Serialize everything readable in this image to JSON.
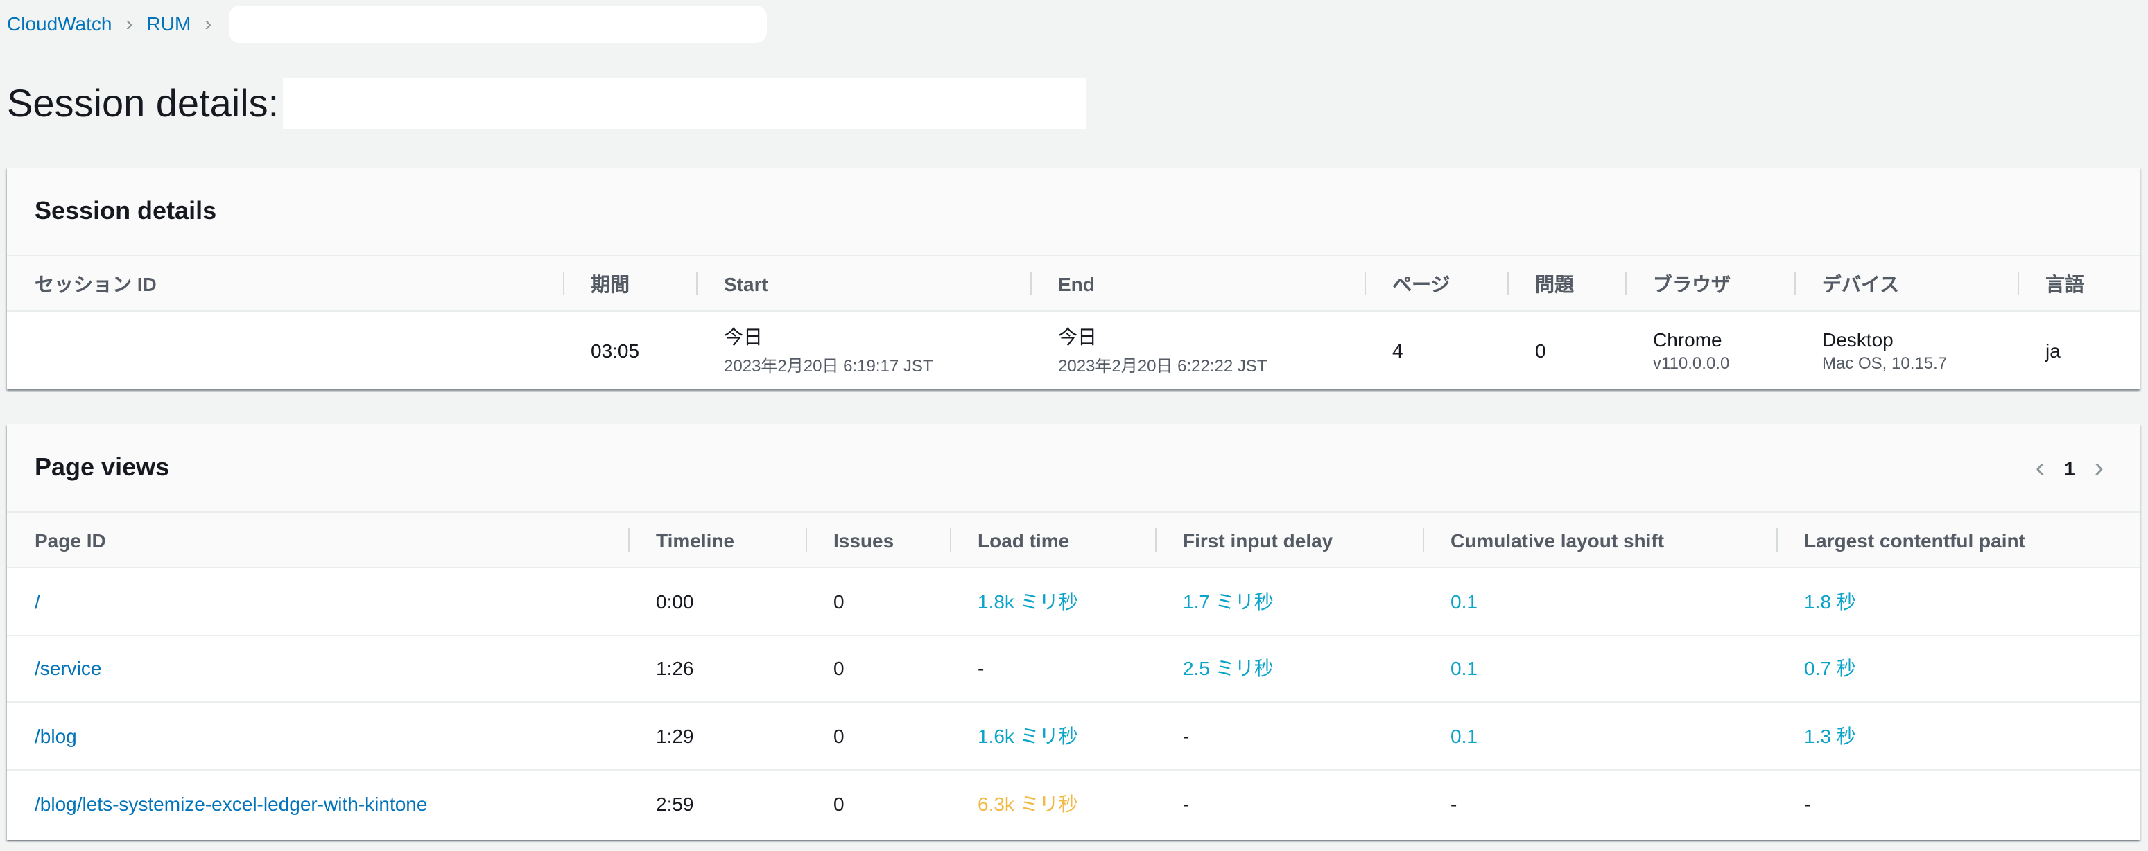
{
  "breadcrumb": {
    "items": [
      "CloudWatch",
      "RUM"
    ]
  },
  "page": {
    "title": "Session details:"
  },
  "session_panel": {
    "title": "Session details",
    "columns": [
      "セッション ID",
      "期間",
      "Start",
      "End",
      "ページ",
      "問題",
      "ブラウザ",
      "デバイス",
      "言語"
    ],
    "row": {
      "session_id": "",
      "duration": "03:05",
      "start_main": "今日",
      "start_sub": "2023年2月20日 6:19:17 JST",
      "end_main": "今日",
      "end_sub": "2023年2月20日 6:22:22 JST",
      "pages": "4",
      "issues": "0",
      "browser_main": "Chrome",
      "browser_sub": "v110.0.0.0",
      "device_main": "Desktop",
      "device_sub": "Mac OS, 10.15.7",
      "language": "ja"
    }
  },
  "page_views": {
    "title": "Page views",
    "pagination": {
      "prev_icon": "chevron-left-icon",
      "current": "1",
      "next_icon": "chevron-right-icon"
    },
    "columns": [
      "Page ID",
      "Timeline",
      "Issues",
      "Load time",
      "First input delay",
      "Cumulative layout shift",
      "Largest contentful paint"
    ],
    "rows": [
      {
        "page_id": "/",
        "timeline": "0:00",
        "issues": "0",
        "load_time": "1.8k ミリ秒",
        "fid": "1.7 ミリ秒",
        "cls": "0.1",
        "lcp": "1.8 秒"
      },
      {
        "page_id": "/service",
        "timeline": "1:26",
        "issues": "0",
        "load_time": "-",
        "fid": "2.5 ミリ秒",
        "cls": "0.1",
        "lcp": "0.7 秒"
      },
      {
        "page_id": "/blog",
        "timeline": "1:29",
        "issues": "0",
        "load_time": "1.6k ミリ秒",
        "fid": "-",
        "cls": "0.1",
        "lcp": "1.3 秒"
      },
      {
        "page_id": "/blog/lets-systemize-excel-ledger-with-kintone",
        "timeline": "2:59",
        "issues": "0",
        "load_time": "6.3k ミリ秒",
        "fid": "-",
        "cls": "-",
        "lcp": "-"
      }
    ]
  },
  "colors": {
    "background": "#f2f3f3",
    "link": "#0073bb",
    "metric_good": "#0aa3c9",
    "metric_warn": "#f2b942"
  }
}
